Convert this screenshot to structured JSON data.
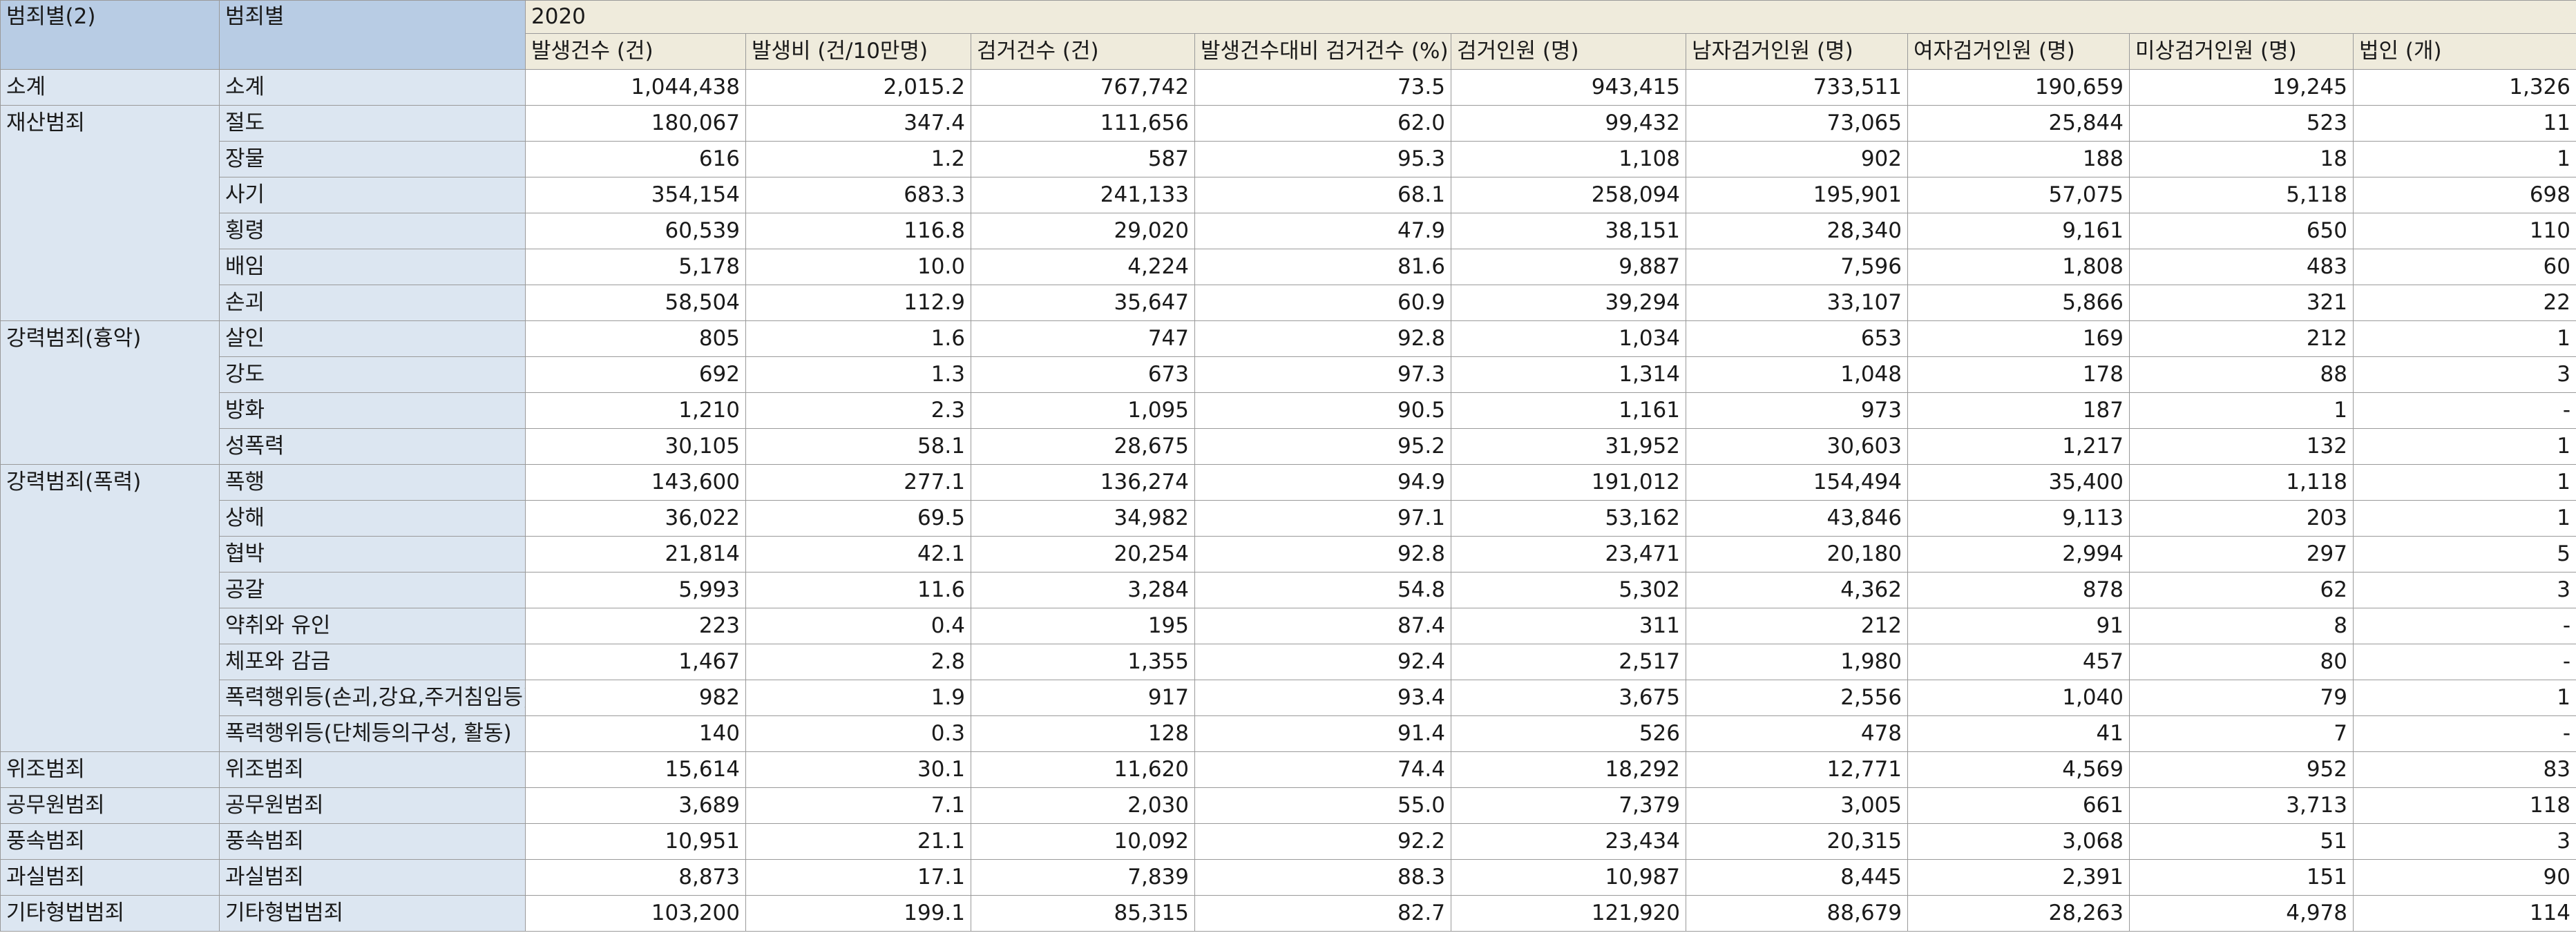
{
  "header": {
    "row_dim1": "범죄별(2)",
    "row_dim2": "범죄별",
    "year": "2020",
    "columns": [
      "발생건수 (건)",
      "발생비 (건/10만명)",
      "검거건수 (건)",
      "발생건수대비 검거건수 (%)",
      "검거인원 (명)",
      "남자검거인원 (명)",
      "여자검거인원 (명)",
      "미상검거인원 (명)",
      "법인 (개)"
    ]
  },
  "rows": [
    {
      "group": "소계",
      "name": "소계",
      "values": [
        "1,044,438",
        "2,015.2",
        "767,742",
        "73.5",
        "943,415",
        "733,511",
        "190,659",
        "19,245",
        "1,326"
      ]
    },
    {
      "group": "재산범죄",
      "name": "절도",
      "values": [
        "180,067",
        "347.4",
        "111,656",
        "62.0",
        "99,432",
        "73,065",
        "25,844",
        "523",
        "11"
      ]
    },
    {
      "group": "",
      "name": "장물",
      "values": [
        "616",
        "1.2",
        "587",
        "95.3",
        "1,108",
        "902",
        "188",
        "18",
        "1"
      ]
    },
    {
      "group": "",
      "name": "사기",
      "values": [
        "354,154",
        "683.3",
        "241,133",
        "68.1",
        "258,094",
        "195,901",
        "57,075",
        "5,118",
        "698"
      ]
    },
    {
      "group": "",
      "name": "횡령",
      "values": [
        "60,539",
        "116.8",
        "29,020",
        "47.9",
        "38,151",
        "28,340",
        "9,161",
        "650",
        "110"
      ]
    },
    {
      "group": "",
      "name": "배임",
      "values": [
        "5,178",
        "10.0",
        "4,224",
        "81.6",
        "9,887",
        "7,596",
        "1,808",
        "483",
        "60"
      ]
    },
    {
      "group": "",
      "name": "손괴",
      "values": [
        "58,504",
        "112.9",
        "35,647",
        "60.9",
        "39,294",
        "33,107",
        "5,866",
        "321",
        "22"
      ]
    },
    {
      "group": "강력범죄(흉악)",
      "name": "살인",
      "values": [
        "805",
        "1.6",
        "747",
        "92.8",
        "1,034",
        "653",
        "169",
        "212",
        "1"
      ]
    },
    {
      "group": "",
      "name": "강도",
      "values": [
        "692",
        "1.3",
        "673",
        "97.3",
        "1,314",
        "1,048",
        "178",
        "88",
        "3"
      ]
    },
    {
      "group": "",
      "name": "방화",
      "values": [
        "1,210",
        "2.3",
        "1,095",
        "90.5",
        "1,161",
        "973",
        "187",
        "1",
        "-"
      ]
    },
    {
      "group": "",
      "name": "성폭력",
      "values": [
        "30,105",
        "58.1",
        "28,675",
        "95.2",
        "31,952",
        "30,603",
        "1,217",
        "132",
        "1"
      ]
    },
    {
      "group": "강력범죄(폭력)",
      "name": "폭행",
      "values": [
        "143,600",
        "277.1",
        "136,274",
        "94.9",
        "191,012",
        "154,494",
        "35,400",
        "1,118",
        "1"
      ]
    },
    {
      "group": "",
      "name": "상해",
      "values": [
        "36,022",
        "69.5",
        "34,982",
        "97.1",
        "53,162",
        "43,846",
        "9,113",
        "203",
        "1"
      ]
    },
    {
      "group": "",
      "name": "협박",
      "values": [
        "21,814",
        "42.1",
        "20,254",
        "92.8",
        "23,471",
        "20,180",
        "2,994",
        "297",
        "5"
      ]
    },
    {
      "group": "",
      "name": "공갈",
      "values": [
        "5,993",
        "11.6",
        "3,284",
        "54.8",
        "5,302",
        "4,362",
        "878",
        "62",
        "3"
      ]
    },
    {
      "group": "",
      "name": "약취와 유인",
      "values": [
        "223",
        "0.4",
        "195",
        "87.4",
        "311",
        "212",
        "91",
        "8",
        "-"
      ]
    },
    {
      "group": "",
      "name": "체포와 감금",
      "values": [
        "1,467",
        "2.8",
        "1,355",
        "92.4",
        "2,517",
        "1,980",
        "457",
        "80",
        "-"
      ]
    },
    {
      "group": "",
      "name": "폭력행위등(손괴,강요,주거침입등)",
      "values": [
        "982",
        "1.9",
        "917",
        "93.4",
        "3,675",
        "2,556",
        "1,040",
        "79",
        "1"
      ]
    },
    {
      "group": "",
      "name": "폭력행위등(단체등의구성, 활동)",
      "values": [
        "140",
        "0.3",
        "128",
        "91.4",
        "526",
        "478",
        "41",
        "7",
        "-"
      ]
    },
    {
      "group": "위조범죄",
      "name": "위조범죄",
      "values": [
        "15,614",
        "30.1",
        "11,620",
        "74.4",
        "18,292",
        "12,771",
        "4,569",
        "952",
        "83"
      ]
    },
    {
      "group": "공무원범죄",
      "name": "공무원범죄",
      "values": [
        "3,689",
        "7.1",
        "2,030",
        "55.0",
        "7,379",
        "3,005",
        "661",
        "3,713",
        "118"
      ]
    },
    {
      "group": "풍속범죄",
      "name": "풍속범죄",
      "values": [
        "10,951",
        "21.1",
        "10,092",
        "92.2",
        "23,434",
        "20,315",
        "3,068",
        "51",
        "3"
      ]
    },
    {
      "group": "과실범죄",
      "name": "과실범죄",
      "values": [
        "8,873",
        "17.1",
        "7,839",
        "88.3",
        "10,987",
        "8,445",
        "2,391",
        "151",
        "90"
      ]
    },
    {
      "group": "기타형법범죄",
      "name": "기타형법범죄",
      "values": [
        "103,200",
        "199.1",
        "85,315",
        "82.7",
        "121,920",
        "88,679",
        "28,263",
        "4,978",
        "114"
      ]
    }
  ],
  "groups": [
    {
      "label": "소계",
      "start": 0,
      "span": 1
    },
    {
      "label": "재산범죄",
      "start": 1,
      "span": 6
    },
    {
      "label": "강력범죄(흉악)",
      "start": 7,
      "span": 4
    },
    {
      "label": "강력범죄(폭력)",
      "start": 11,
      "span": 8
    },
    {
      "label": "위조범죄",
      "start": 19,
      "span": 1
    },
    {
      "label": "공무원범죄",
      "start": 20,
      "span": 1
    },
    {
      "label": "풍속범죄",
      "start": 21,
      "span": 1
    },
    {
      "label": "과실범죄",
      "start": 22,
      "span": 1
    },
    {
      "label": "기타형법범죄",
      "start": 23,
      "span": 1
    }
  ],
  "colors": {
    "corner_bg": "#b8cce4",
    "column_header_bg": "#efebdc",
    "row_header_bg": "#dce6f1",
    "cell_bg": "#ffffff",
    "grid_line": "#9a9a9a"
  }
}
